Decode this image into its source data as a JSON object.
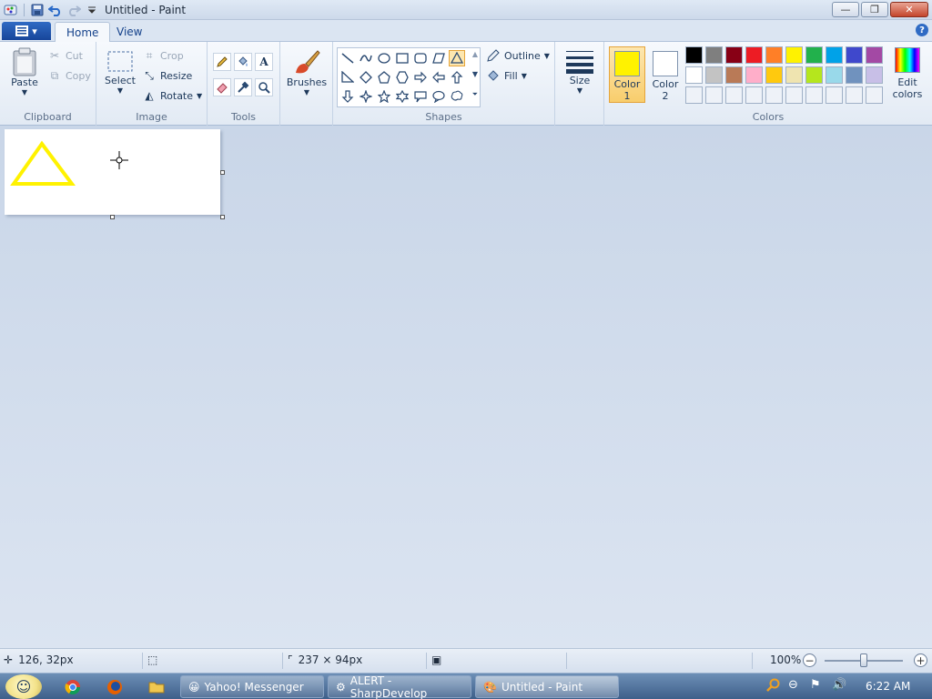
{
  "window": {
    "title": "Untitled - Paint",
    "controls": {
      "minimize": "—",
      "restore": "❐",
      "close": "✕"
    }
  },
  "quick_access": {
    "app_icon": "paint-icon",
    "save_icon": "save-icon",
    "undo_icon": "undo-icon",
    "redo_icon": "redo-icon",
    "customize_icon": "chevron-down-icon"
  },
  "tabs": [
    {
      "label": "Home",
      "active": true
    },
    {
      "label": "View",
      "active": false
    }
  ],
  "ribbon": {
    "clipboard": {
      "label": "Clipboard",
      "paste": "Paste",
      "cut": "Cut",
      "copy": "Copy"
    },
    "image": {
      "label": "Image",
      "select": "Select",
      "crop": "Crop",
      "resize": "Resize",
      "rotate": "Rotate"
    },
    "tools": {
      "label": "Tools"
    },
    "brushes": {
      "label": "Brushes"
    },
    "shapes": {
      "label": "Shapes",
      "outline": "Outline",
      "fill": "Fill",
      "selected_shape": "triangle"
    },
    "size": {
      "label": "Size"
    },
    "colors": {
      "label": "Colors",
      "color1_label": "Color",
      "color1_num": "1",
      "color2_label": "Color",
      "color2_num": "2",
      "color1": "#FFF200",
      "color2": "#FFFFFF",
      "edit_label_1": "Edit",
      "edit_label_2": "colors",
      "palette_row1": [
        "#000000",
        "#7F7F7F",
        "#880015",
        "#ED1C24",
        "#FF7F27",
        "#FFF200",
        "#22B14C",
        "#00A2E8",
        "#3F48CC",
        "#A349A4"
      ],
      "palette_row2": [
        "#FFFFFF",
        "#C3C3C3",
        "#B97A57",
        "#FFAEC9",
        "#FFC90E",
        "#EFE4B0",
        "#B5E61D",
        "#99D9EA",
        "#7092BE",
        "#C8BFE7"
      ]
    }
  },
  "canvas": {
    "shape_color": "#FFF200"
  },
  "status": {
    "cursor_pos": "126, 32px",
    "image_size": "237 × 94px",
    "zoom": "100%",
    "zoom_level": 0.5
  },
  "taskbar": {
    "tasks": [
      {
        "label": "Yahoo! Messenger"
      },
      {
        "label": "ALERT - SharpDevelop"
      },
      {
        "label": "Untitled - Paint"
      }
    ],
    "clock": "6:22 AM"
  }
}
